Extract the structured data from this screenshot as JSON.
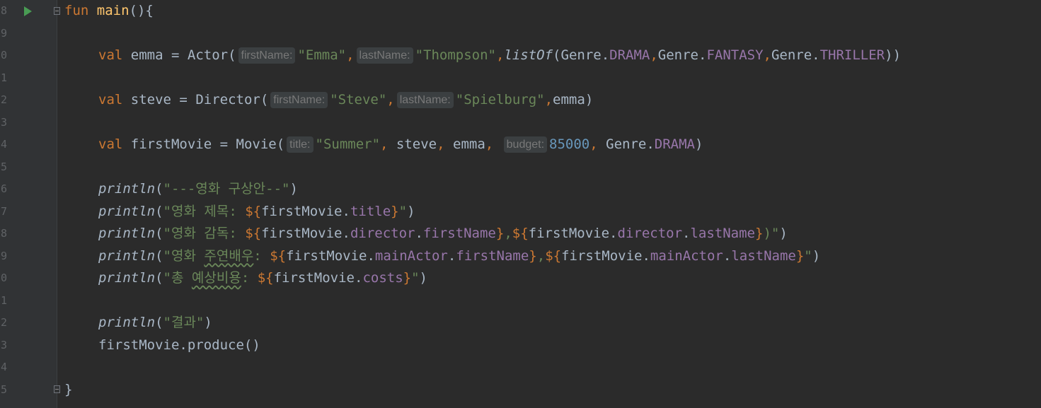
{
  "editor": {
    "line_numbers": [
      "8",
      "9",
      "0",
      "1",
      "2",
      "3",
      "4",
      "5",
      "6",
      "7",
      "8",
      "9",
      "0",
      "1",
      "2",
      "3",
      "4",
      "5"
    ],
    "lines": {
      "l8": {
        "kw": "fun",
        "name": "main",
        "rest": "(){"
      },
      "l10": {
        "kw": "val",
        "var": "emma",
        "eq": " = ",
        "cls": "Actor",
        "open": "(",
        "hint1": "firstName:",
        "s1": "\"Emma\"",
        "c1": ",",
        "hint2": "lastName:",
        "s2": "\"Thompson\"",
        "c2": ",",
        "fn": "listOf",
        "p": "(",
        "g1": "Genre.",
        "e1": "DRAMA",
        "c3": ",",
        "g2": "Genre.",
        "e2": "FANTASY",
        "c4": ",",
        "g3": "Genre.",
        "e3": "THRILLER",
        "close": "))"
      },
      "l12": {
        "kw": "val",
        "var": "steve",
        "eq": " = ",
        "cls": "Director",
        "open": "(",
        "hint1": "firstName:",
        "s1": "\"Steve\"",
        "c1": ",",
        "hint2": "lastName:",
        "s2": "\"Spielburg\"",
        "c2": ",",
        "arg": "emma",
        "close": ")"
      },
      "l14": {
        "kw": "val",
        "var": "firstMovie",
        "eq": " = ",
        "cls": "Movie",
        "open": "(",
        "hint1": "title:",
        "s1": "\"Summer\"",
        "c1": ", ",
        "a1": "steve",
        "c2": ", ",
        "a2": "emma",
        "c3": ", ",
        "hint2": "budget:",
        "n1": "85000",
        "c4": ", ",
        "g1": "Genre.",
        "e1": "DRAMA",
        "close": ")"
      },
      "l16": {
        "fn": "println",
        "open": "(",
        "s": "\"---영화 구상안--\"",
        "close": ")"
      },
      "l17": {
        "fn": "println",
        "open": "(",
        "s1": "\"영화 제목: ",
        "t1": "${",
        "v1": "firstMovie.",
        "p1": "title",
        "t2": "}",
        "s2": "\"",
        "close": ")"
      },
      "l18": {
        "fn": "println",
        "open": "(",
        "s1": "\"영화 감독: ",
        "t1": "${",
        "v1": "firstMovie.",
        "p1": "director",
        "d1": ".",
        "p2": "firstName",
        "t2": "}",
        "c": ",",
        "t3": "${",
        "v2": "firstMovie.",
        "p3": "director",
        "d2": ".",
        "p4": "lastName",
        "t4": "}",
        "s2": ")\"",
        "close": ")"
      },
      "l19": {
        "fn": "println",
        "open": "(",
        "s1a": "\"영화 ",
        "s1b": "주연배우",
        "s1c": ": ",
        "t1": "${",
        "v1": "firstMovie.",
        "p1": "mainActor",
        "d1": ".",
        "p2": "firstName",
        "t2": "}",
        "c": ",",
        "t3": "${",
        "v2": "firstMovie.",
        "p3": "mainActor",
        "d2": ".",
        "p4": "lastName",
        "t4": "}",
        "s2": "\"",
        "close": ")"
      },
      "l20": {
        "fn": "println",
        "open": "(",
        "s1a": "\"총 ",
        "s1b": "예상비용",
        "s1c": ": ",
        "t1": "${",
        "v1": "firstMovie.",
        "p1": "costs",
        "t2": "}",
        "s2": "\"",
        "close": ")"
      },
      "l22": {
        "fn": "println",
        "open": "(",
        "s": "\"결과\"",
        "close": ")"
      },
      "l23": {
        "code": "firstMovie.produce()"
      },
      "l25": {
        "code": "}"
      }
    },
    "colors": {
      "background": "#2b2b2b",
      "gutter": "#313335",
      "keyword": "#cc7832",
      "function": "#ffc66d",
      "string": "#6a8759",
      "number": "#6897bb",
      "property": "#9876aa",
      "identifier": "#a9b7c6",
      "run": "#499c54"
    }
  }
}
